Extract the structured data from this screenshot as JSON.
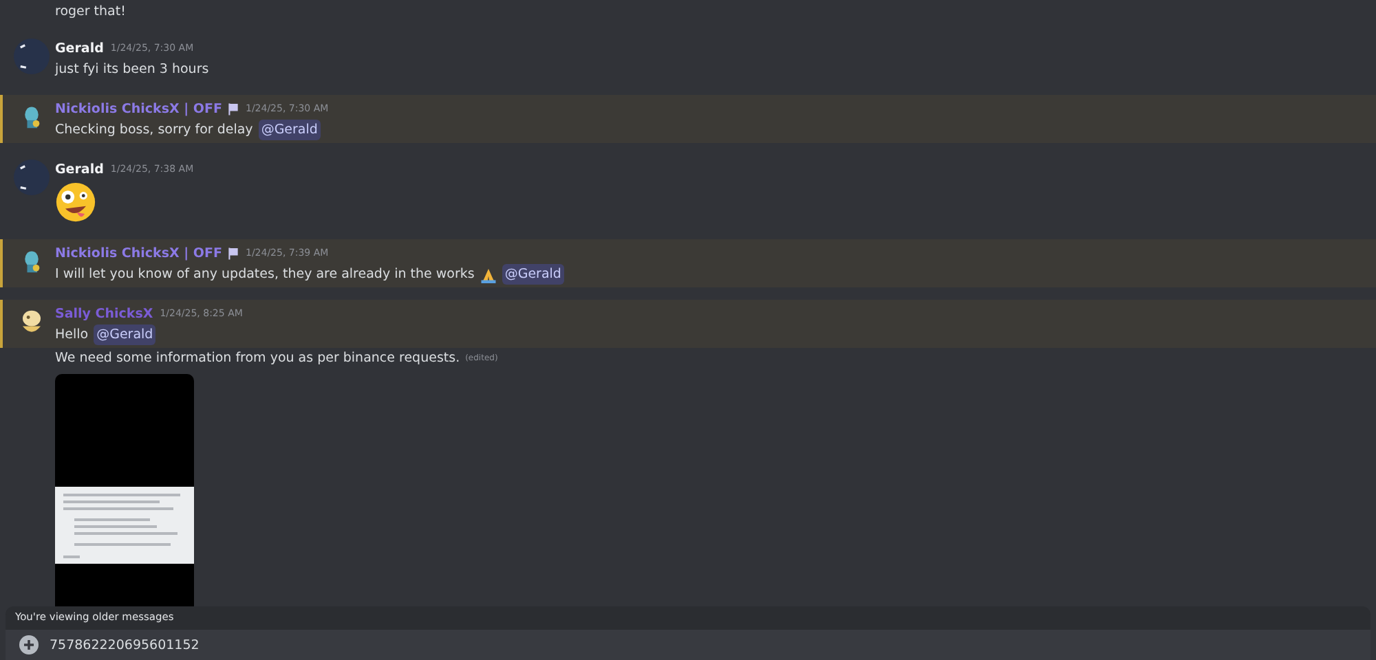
{
  "messages": [
    {
      "header": false,
      "highlighted": false,
      "kind": "none",
      "parts": [
        [
          {
            "kind": "text",
            "text": "roger that!"
          }
        ]
      ]
    },
    {
      "header": true,
      "highlighted": false,
      "kind": "dark",
      "author": "Gerald",
      "color": "#f2f3f5",
      "flag": false,
      "time": "1/24/25, 7:30 AM",
      "parts": [
        [
          {
            "kind": "text",
            "text": "just fyi its been 3 hours"
          }
        ]
      ]
    },
    {
      "header": true,
      "highlighted": true,
      "kind": "cyan",
      "author": "Nickiolis ChicksX | OFF",
      "color": "#8c7ae6",
      "flag": true,
      "time": "1/24/25, 7:30 AM",
      "parts": [
        [
          {
            "kind": "text",
            "text": "Checking boss, sorry for delay"
          },
          {
            "kind": "mention",
            "text": "@Gerald"
          }
        ]
      ]
    },
    {
      "header": true,
      "highlighted": false,
      "kind": "dark",
      "author": "Gerald",
      "color": "#f2f3f5",
      "flag": false,
      "time": "1/24/25, 7:38 AM",
      "parts": [
        [
          {
            "kind": "emoji"
          }
        ]
      ]
    },
    {
      "header": true,
      "highlighted": true,
      "kind": "cyan",
      "author": "Nickiolis ChicksX | OFF",
      "color": "#8c7ae6",
      "flag": true,
      "time": "1/24/25, 7:39 AM",
      "parts": [
        [
          {
            "kind": "text",
            "text": "I will let you know of any updates, they are already in the works"
          },
          {
            "kind": "pray"
          },
          {
            "kind": "mention",
            "text": "@Gerald"
          }
        ]
      ]
    },
    {
      "header": true,
      "highlighted": true,
      "kind": "yellow",
      "author": "Sally ChicksX",
      "color": "#7b5cd6",
      "flag": false,
      "time": "1/24/25, 8:25 AM",
      "parts": [
        [
          {
            "kind": "text",
            "text": "Hello"
          },
          {
            "kind": "mention",
            "text": "@Gerald"
          }
        ]
      ]
    },
    {
      "header": false,
      "highlighted": false,
      "kind": "none",
      "parts": [
        [
          {
            "kind": "text",
            "text": "We need some information from you as per binance requests."
          },
          {
            "kind": "edited",
            "text": "(edited)"
          }
        ],
        [
          {
            "kind": "picture"
          }
        ]
      ]
    }
  ],
  "notice": "You're viewing older messages",
  "composer": {
    "value": "757862220695601152"
  }
}
